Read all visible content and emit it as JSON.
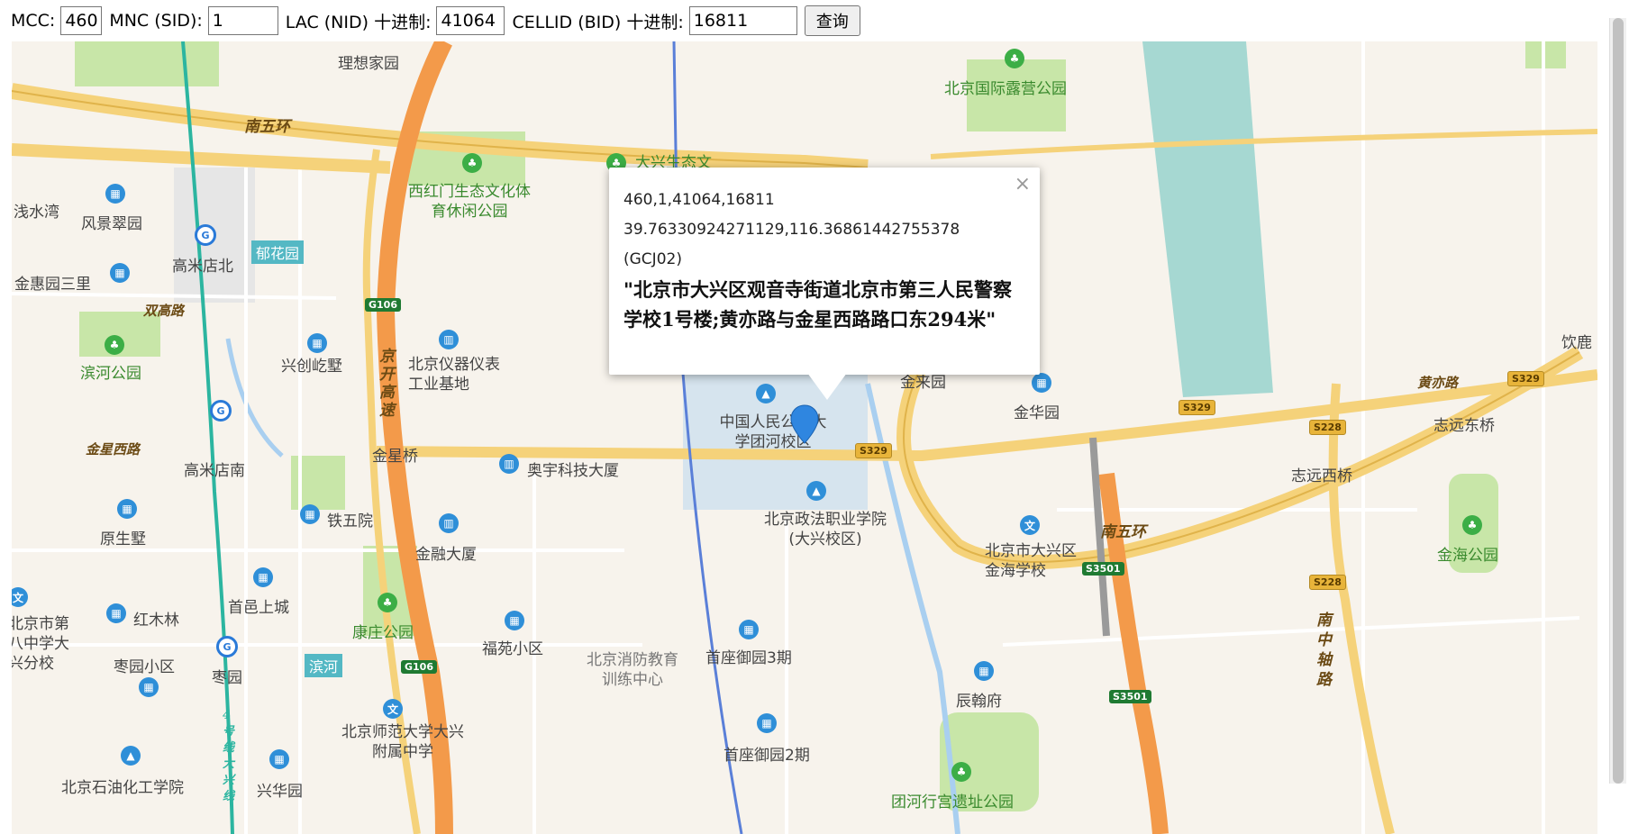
{
  "form": {
    "mcc_label": "MCC:",
    "mcc_value": "460",
    "mnc_label": "MNC (SID):",
    "mnc_value": "1",
    "lac_label": "LAC (NID) 十进制:",
    "lac_value": "41064",
    "cell_label": "CELLID (BID) 十进制:",
    "cell_value": "16811",
    "query_button": "查询"
  },
  "popup": {
    "close": "×",
    "codes": "460,1,41064,16811",
    "coords": "39.76330924271129,116.36861442755378",
    "datum": "(GCJ02)",
    "address": "\"北京市大兴区观音寺街道北京市第三人民警察学校1号楼;黄亦路与金星西路路口东294米\""
  },
  "map": {
    "places": {
      "lixiang": "理想家园",
      "camp_park": "北京国际露营公园",
      "nanwuhuan_w": "南五环",
      "daxing_eco": "大兴生态文",
      "xihongmen": "西红门生态文化体育休闲公园",
      "qianshuiwan": "浅水湾",
      "fengjingcui": "风景翠园",
      "gaomidian_n": "高米店北",
      "yuhuayuan": "郁花园",
      "jinhuiyuan": "金惠园三里",
      "shuanggao": "双高路",
      "binhe_park": "滨河公园",
      "xingchuang": "兴创屹墅",
      "instrument": "北京仪器仪表工业基地",
      "jingkai": "京开高速",
      "g106": "G106",
      "jinxingxi": "金星西路",
      "gaomidian_s": "高米店南",
      "jinxingqiao": "金星桥",
      "aoyu": "奥宇科技大厦",
      "renda": "中国人民公安大学团河校区",
      "s329": "S329",
      "zhengfa": "北京政法职业学院(大兴校区)",
      "jinhuayuan": "金华园",
      "huangyi": "黄亦路",
      "zhiyuan_e": "志远东桥",
      "zhiyuan_w": "志远西桥",
      "yinlu": "饮鹿",
      "yuanshengshu": "原生墅",
      "tiewuyuan": "铁五院",
      "jinrong": "金融大厦",
      "jinhai_school": "北京市大兴区金海学校",
      "nanwuhuan_e": "南五环",
      "s3501": "S3501",
      "s228": "S228",
      "jinhai_park": "金海公园",
      "hongmulin": "红木林",
      "shouyi": "首邑上城",
      "beijing8": "北京市第八中学大兴分校",
      "kangzhuang": "康庄公园",
      "fuyuan": "福苑小区",
      "fire": "北京消防教育训练中心",
      "shouzuo3": "首座御园3期",
      "nanzhongzhou": "南中轴路",
      "zaoyuan_xq": "枣园小区",
      "zaoyuan": "枣园",
      "binhe": "滨河",
      "chenhan": "辰翰府",
      "shifan": "北京师范大学大兴附属中学",
      "shouzuo2": "首座御园2期",
      "shiyou": "北京石油化工学院",
      "xinghua": "兴华园",
      "tuanhe_palace": "团河行宫遗址公园",
      "jinlaiyuan": "金来园",
      "line4": "4号线大兴线"
    },
    "colors": {
      "expressway": "#f39a4a",
      "major_road": "#f5d27a",
      "water": "#a6d8d2",
      "park": "#c8e6a8",
      "campus": "#d6e4ee",
      "metro": "#2cb5a0"
    }
  }
}
